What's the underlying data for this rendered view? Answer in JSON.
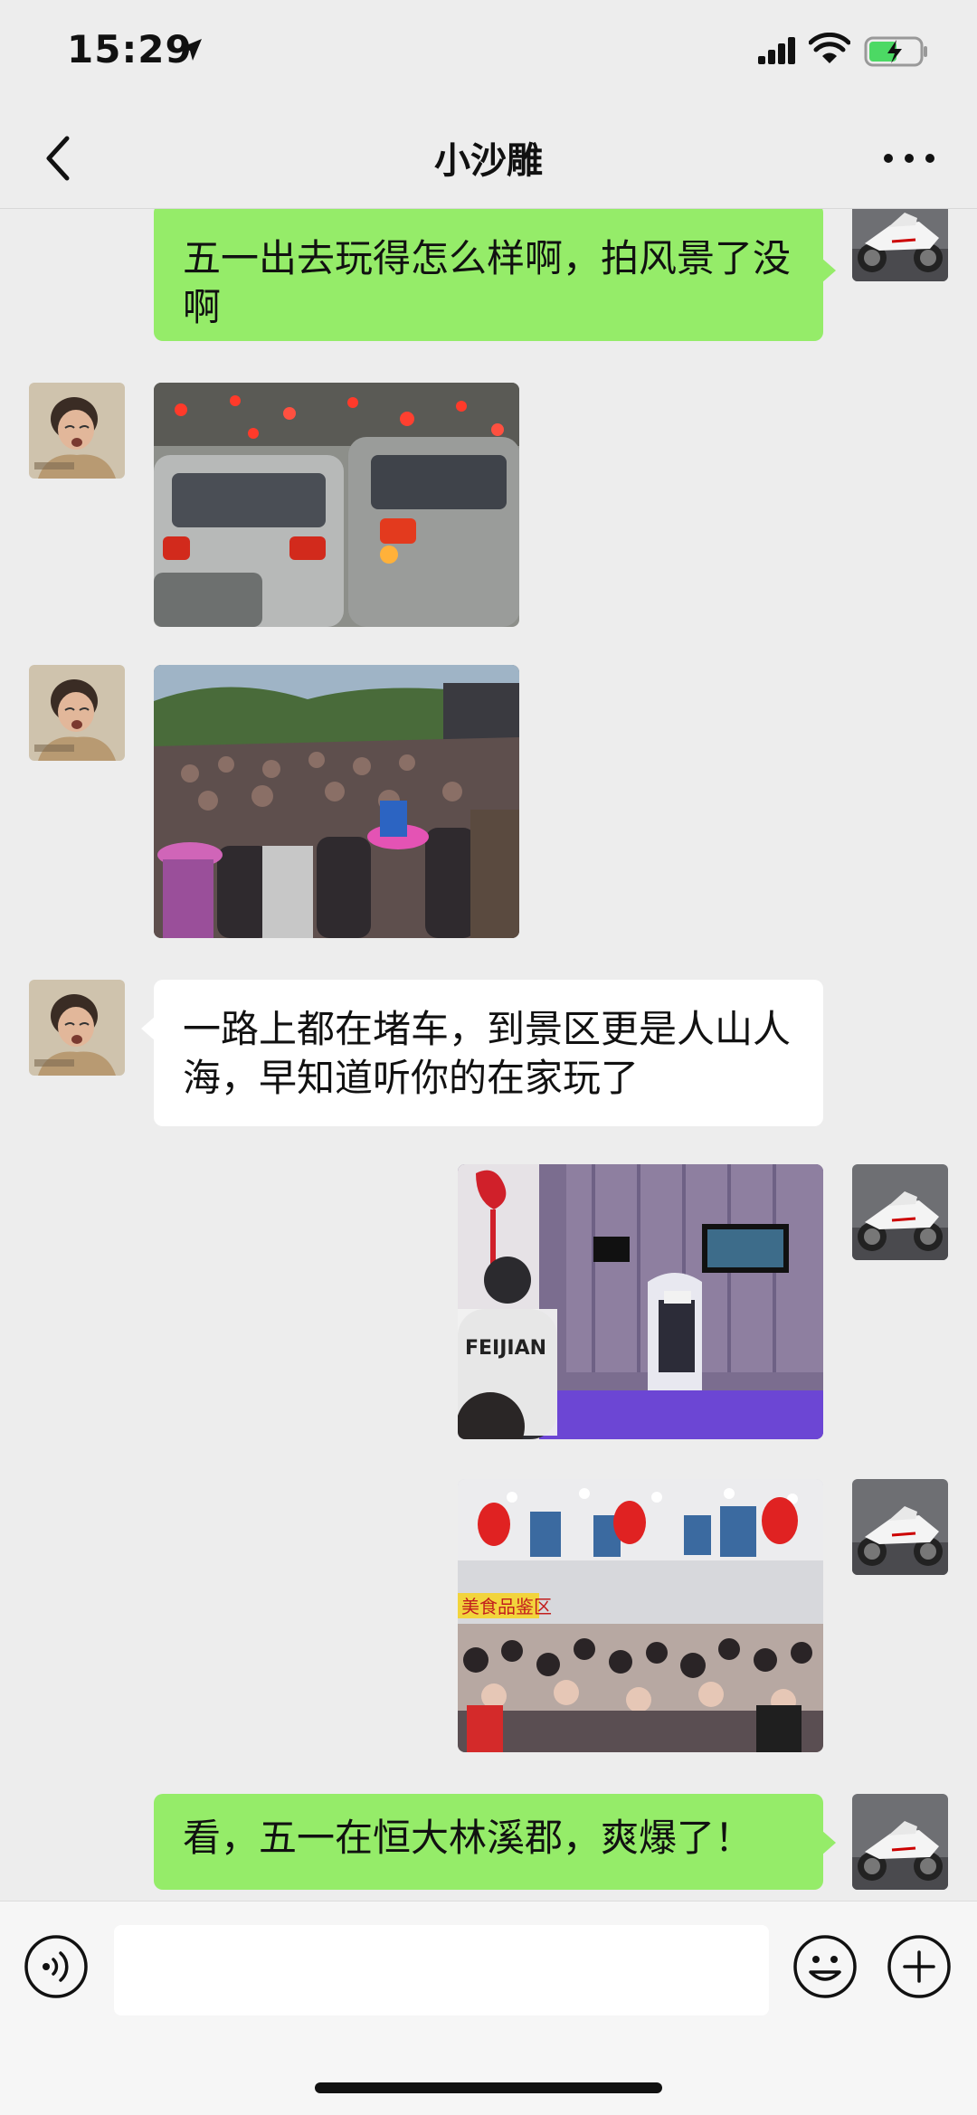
{
  "status_bar": {
    "time": "15:29"
  },
  "header": {
    "title": "小沙雕"
  },
  "messages": [
    {
      "sender": "me",
      "type": "text",
      "text": "五一出去玩得怎么样啊，拍风景了没啊"
    },
    {
      "sender": "other",
      "type": "image",
      "image": "traffic-jam-photo"
    },
    {
      "sender": "other",
      "type": "image",
      "image": "crowded-scenic-area-photo"
    },
    {
      "sender": "other",
      "type": "text",
      "text": "一路上都在堵车，到景区更是人山人海，早知道听你的在家玩了"
    },
    {
      "sender": "me",
      "type": "image",
      "image": "vr-experience-photo"
    },
    {
      "sender": "me",
      "type": "image",
      "image": "food-hall-crowd-photo"
    },
    {
      "sender": "me",
      "type": "text",
      "text": "看，五一在恒大林溪郡，爽爆了！"
    }
  ],
  "photo_text": {
    "vr_shirt": "FEIJIAN",
    "food_sign": "美食品鉴区"
  },
  "input_bar": {
    "placeholder": ""
  },
  "colors": {
    "my_bubble": "#95ec69",
    "other_bubble": "#ffffff",
    "background": "#ededed"
  }
}
